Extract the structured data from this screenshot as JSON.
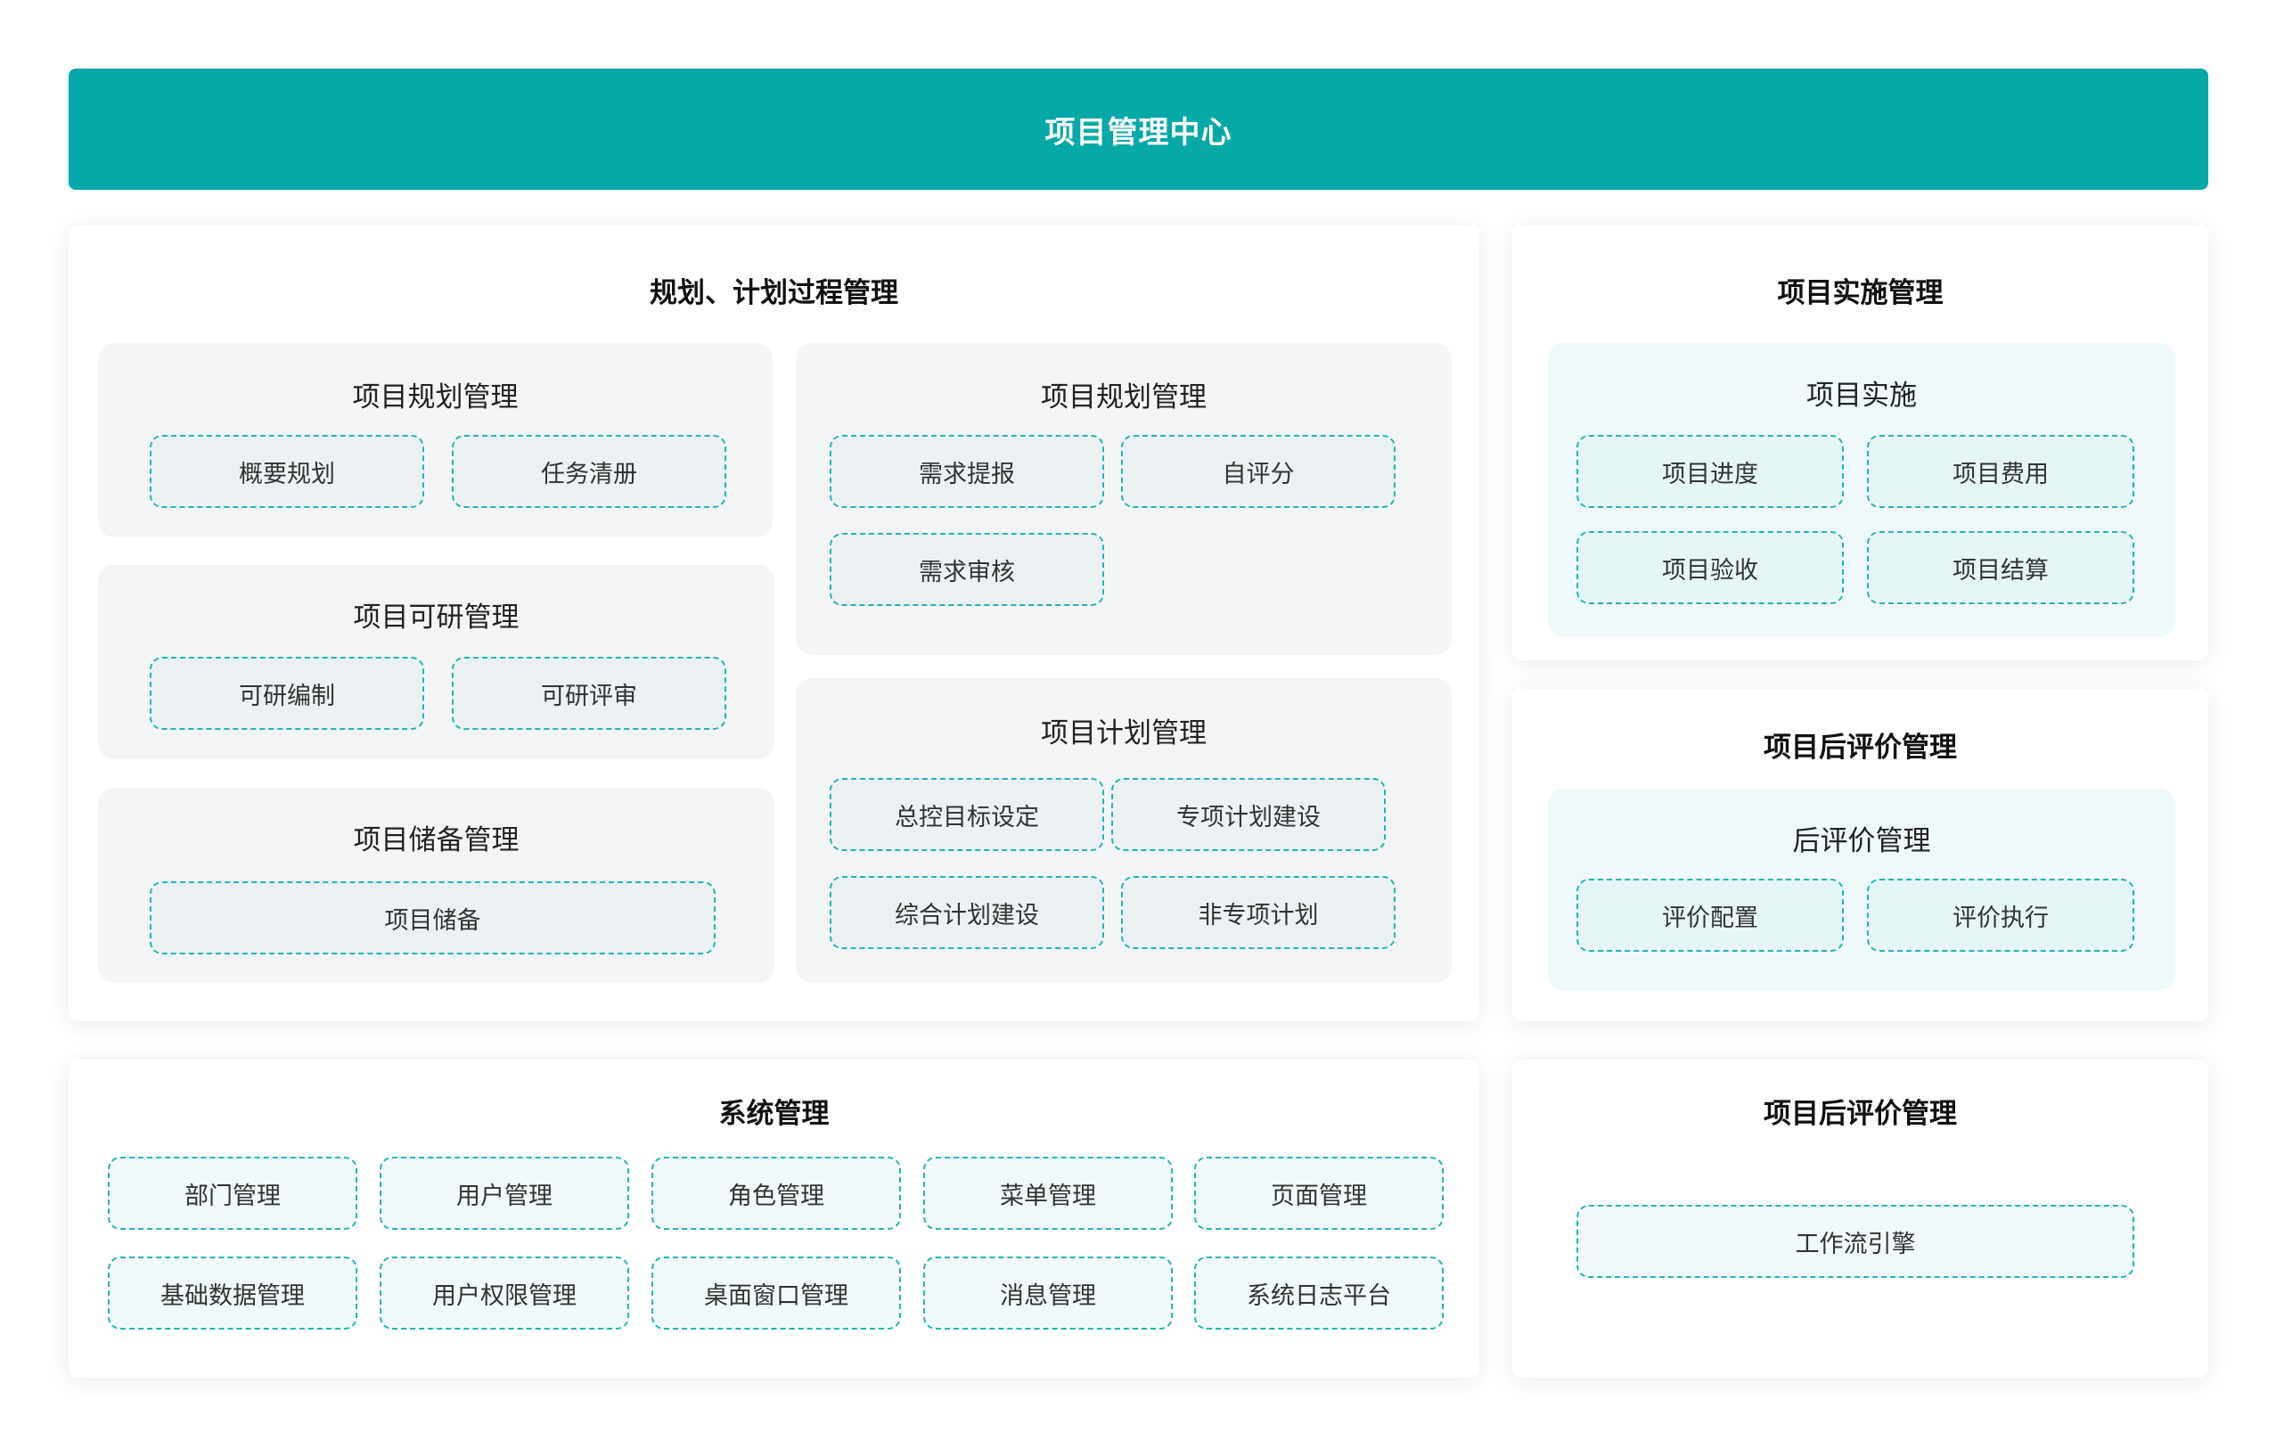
{
  "header": {
    "title": "项目管理中心"
  },
  "planning": {
    "title": "规划、计划过程管理",
    "groups": {
      "plan_left": {
        "title": "项目规划管理",
        "items": [
          "概要规划",
          "任务清册"
        ]
      },
      "feasibility": {
        "title": "项目可研管理",
        "items": [
          "可研编制",
          "可研评审"
        ]
      },
      "reserve": {
        "title": "项目储备管理",
        "items": [
          "项目储备"
        ]
      },
      "plan_right": {
        "title": "项目规划管理",
        "items": [
          "需求提报",
          "自评分",
          "需求审核"
        ]
      },
      "schedule": {
        "title": "项目计划管理",
        "items": [
          "总控目标设定",
          "专项计划建设",
          "综合计划建设",
          "非专项计划"
        ]
      }
    }
  },
  "implementation": {
    "title": "项目实施管理",
    "group": {
      "title": "项目实施",
      "items": [
        "项目进度",
        "项目费用",
        "项目验收",
        "项目结算"
      ]
    }
  },
  "post_eval": {
    "title": "项目后评价管理",
    "group": {
      "title": "后评价管理",
      "items": [
        "评价配置",
        "评价执行"
      ]
    }
  },
  "system": {
    "title": "系统管理",
    "items": [
      "部门管理",
      "用户管理",
      "角色管理",
      "菜单管理",
      "页面管理",
      "基础数据管理",
      "用户权限管理",
      "桌面窗口管理",
      "消息管理",
      "系统日志平台"
    ]
  },
  "workflow": {
    "title": "项目后评价管理",
    "items": [
      "工作流引擎"
    ]
  }
}
